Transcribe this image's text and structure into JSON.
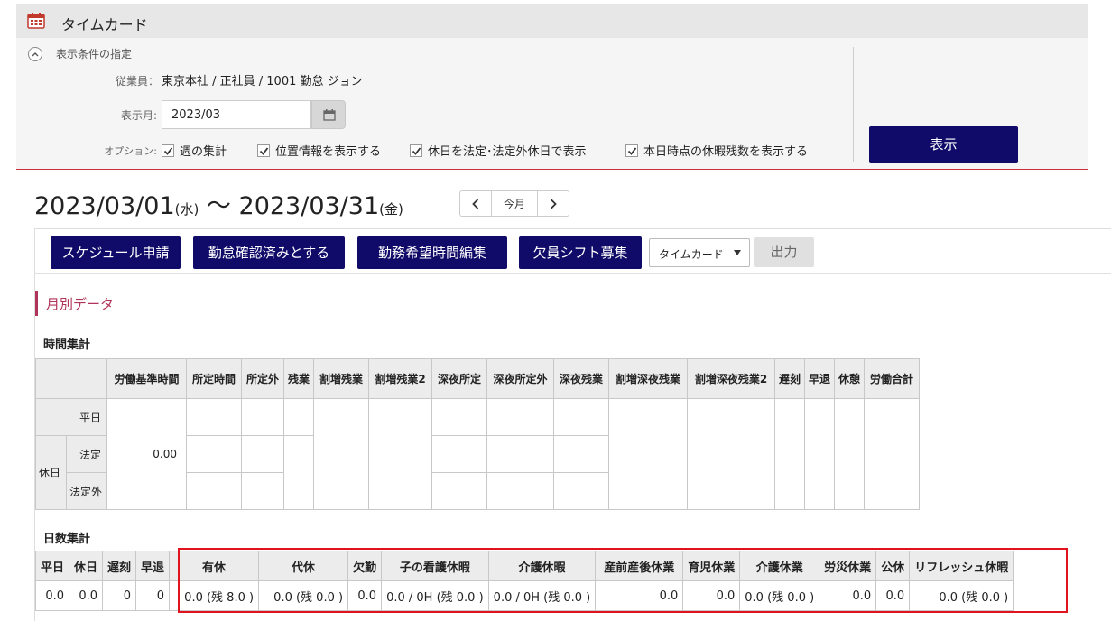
{
  "header": {
    "title": "タイムカード"
  },
  "filter": {
    "section_title": "表示条件の指定",
    "employee_label": "従業員：",
    "employee_value": "東京本社 / 正社員 / 1001 勤怠 ジョン",
    "month_label": "表示月:",
    "month_value": "2023/03",
    "options_label": "オプション:",
    "options": [
      {
        "label": "週の集計",
        "checked": true
      },
      {
        "label": "位置情報を表示する",
        "checked": true
      },
      {
        "label": "休日を法定･法定外休日で表示",
        "checked": true
      },
      {
        "label": "本日時点の休暇残数を表示する",
        "checked": true
      }
    ],
    "show_button": "表示"
  },
  "range": {
    "start": "2023/03/01",
    "start_dow": "(水)",
    "sep": " 〜 ",
    "end": "2023/03/31",
    "end_dow": "(金)"
  },
  "pager": {
    "prev": "<",
    "current": "今月",
    "next": ">"
  },
  "toolbar": {
    "schedule": "スケジュール申請",
    "confirm": "勤怠確認済みとする",
    "wish": "勤務希望時間編集",
    "shift": "欠員シフト募集",
    "select_value": "タイムカード",
    "export": "出力"
  },
  "monthly": {
    "title": "月別データ"
  },
  "time_summary": {
    "heading": "時間集計",
    "columns": [
      "労働基準時間",
      "所定時間",
      "所定外",
      "残業",
      "割増残業",
      "割増残業2",
      "深夜所定",
      "深夜所定外",
      "深夜残業",
      "割増深夜残業",
      "割増深夜残業2",
      "遅刻",
      "早退",
      "休憩",
      "労働合計"
    ],
    "rows": {
      "weekday": "平日",
      "holiday": "休日",
      "legal": "法定",
      "non_legal": "法定外"
    },
    "base_value": "0.00"
  },
  "day_summary": {
    "heading": "日数集計",
    "columns": [
      "平日",
      "休日",
      "遅刻",
      "早退",
      "有休",
      "代休",
      "欠勤",
      "子の看護休暇",
      "介護休暇",
      "産前産後休業",
      "育児休業",
      "介護休業",
      "労災休業",
      "公休",
      "リフレッシュ休暇"
    ],
    "values": [
      "0.0",
      "0.0",
      "0",
      "0",
      "0.0 (残 8.0 )",
      "0.0 (残 0.0 )",
      "0.0",
      "0.0 / 0H (残 0.0 )",
      "0.0 / 0H (残 0.0 )",
      "0.0",
      "0.0",
      "0.0 (残 0.0 )",
      "0.0",
      "0.0",
      "0.0 (残 0.0 )"
    ]
  },
  "colors": {
    "navy": "#100b68",
    "accent": "#b0345a",
    "highlight": "#e1131f"
  }
}
